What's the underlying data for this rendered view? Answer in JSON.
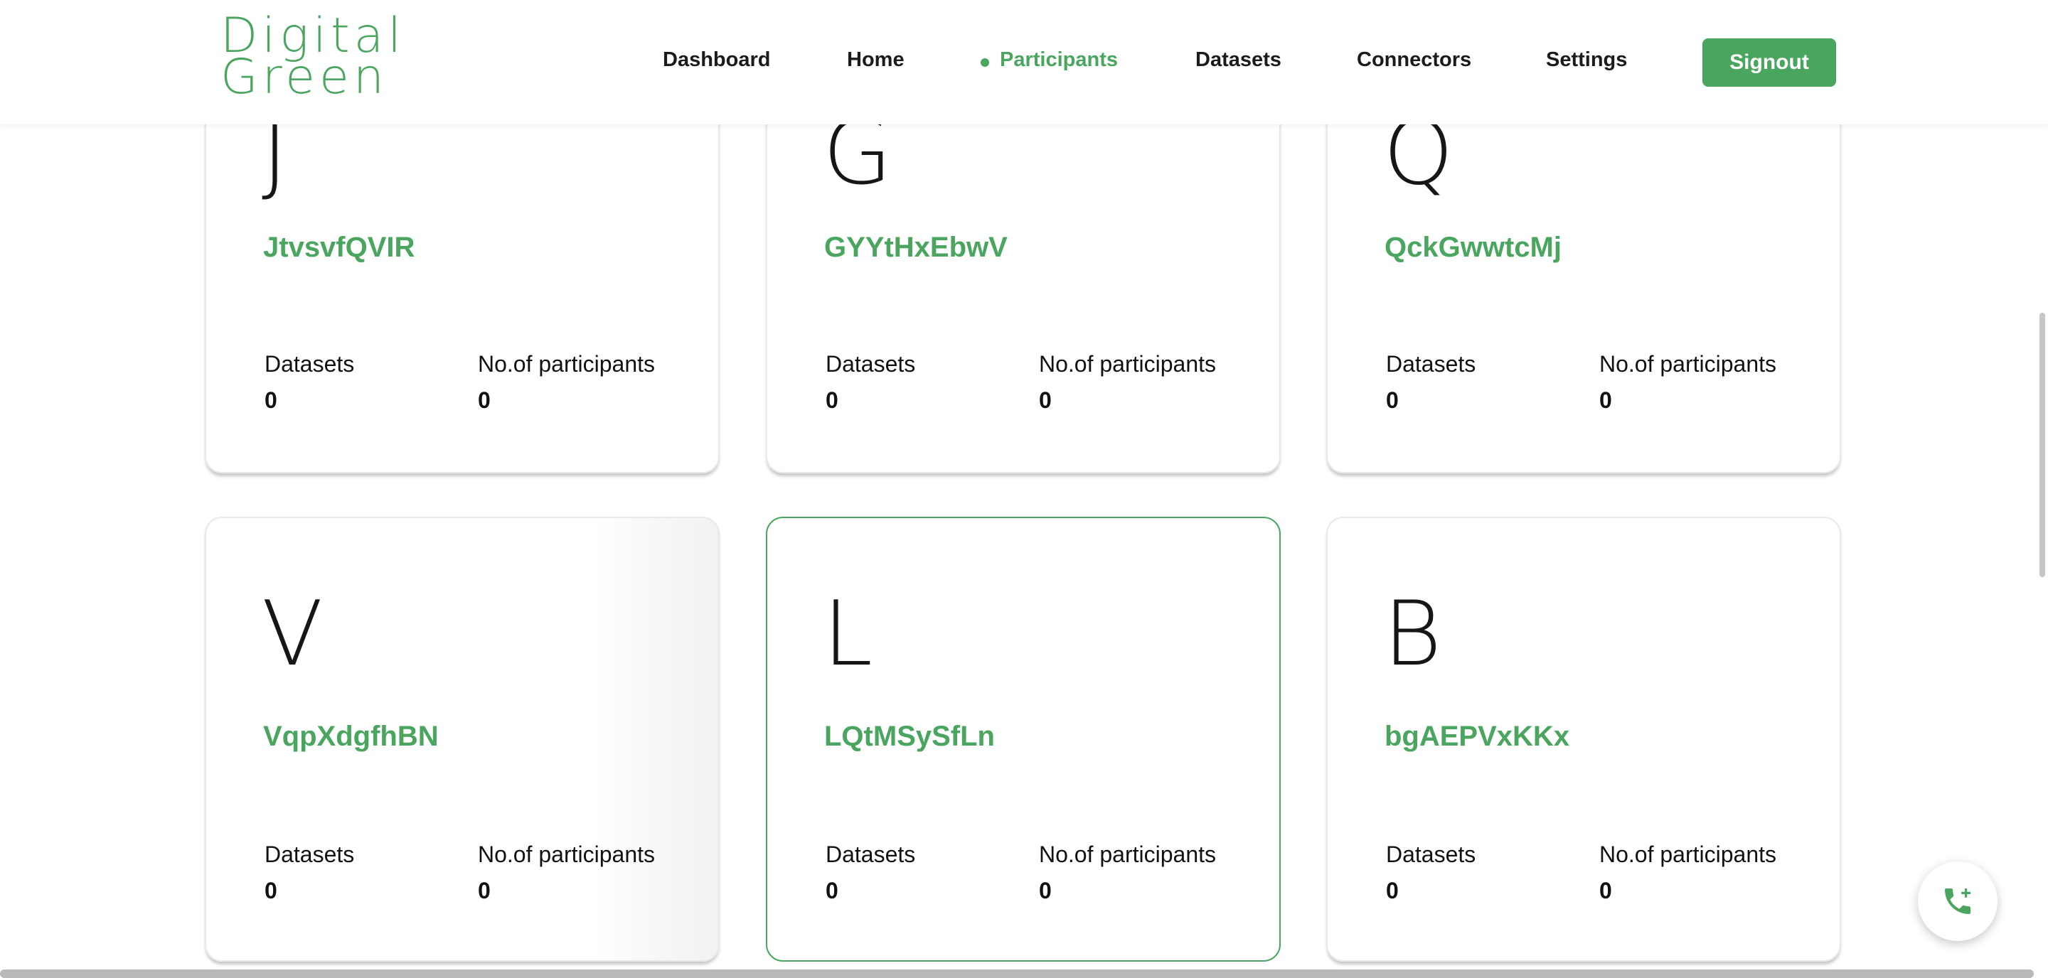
{
  "header": {
    "logo": {
      "line1": "Digital",
      "line2": "Green"
    },
    "nav": [
      {
        "label": "Dashboard",
        "active": false
      },
      {
        "label": "Home",
        "active": false
      },
      {
        "label": "Participants",
        "active": true
      },
      {
        "label": "Datasets",
        "active": false
      },
      {
        "label": "Connectors",
        "active": false
      },
      {
        "label": "Settings",
        "active": false
      }
    ],
    "signout_label": "Signout"
  },
  "cards": [
    {
      "initial": "J",
      "name": "JtvsvfQVIR",
      "datasets_label": "Datasets",
      "datasets_value": "0",
      "participants_label": "No.of participants",
      "participants_value": "0"
    },
    {
      "initial": "G",
      "name": "GYYtHxEbwV",
      "datasets_label": "Datasets",
      "datasets_value": "0",
      "participants_label": "No.of participants",
      "participants_value": "0"
    },
    {
      "initial": "Q",
      "name": "QckGwwtcMj",
      "datasets_label": "Datasets",
      "datasets_value": "0",
      "participants_label": "No.of participants",
      "participants_value": "0"
    },
    {
      "initial": "V",
      "name": "VqpXdgfhBN",
      "datasets_label": "Datasets",
      "datasets_value": "0",
      "participants_label": "No.of participants",
      "participants_value": "0"
    },
    {
      "initial": "L",
      "name": "LQtMSySfLn",
      "datasets_label": "Datasets",
      "datasets_value": "0",
      "participants_label": "No.of participants",
      "participants_value": "0"
    },
    {
      "initial": "B",
      "name": "bgAEPVxKKx",
      "datasets_label": "Datasets",
      "datasets_value": "0",
      "participants_label": "No.of participants",
      "participants_value": "0"
    }
  ],
  "fab": {
    "icon": "phone-add-icon"
  },
  "colors": {
    "accent": "#4aa55f",
    "text": "#111111",
    "card_border": "#e9e9e9"
  }
}
